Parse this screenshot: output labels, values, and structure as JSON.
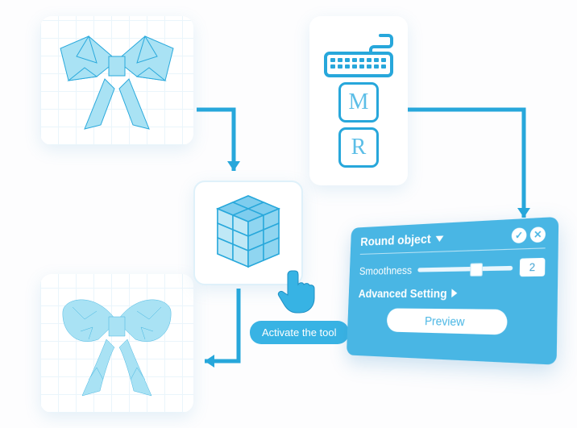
{
  "diagram": {
    "step_before_label": "Low-poly bow model (input)",
    "step_after_label": "Rounded / smoothed bow model (output)",
    "tool_name": "Round object tool",
    "activate_label": "Activate the tool"
  },
  "shortcut": {
    "device": "keyboard",
    "key1": "M",
    "key2": "R"
  },
  "panel": {
    "title": "Round  object",
    "smoothness_label": "Smoothness",
    "smoothness_value": "2",
    "advanced_label": "Advanced Setting",
    "preview_label": "Preview",
    "confirm_icon": "check",
    "close_icon": "close"
  },
  "colors": {
    "primary": "#27a7db",
    "panel": "#49b6e4",
    "fill_light": "#bfe8f6"
  }
}
